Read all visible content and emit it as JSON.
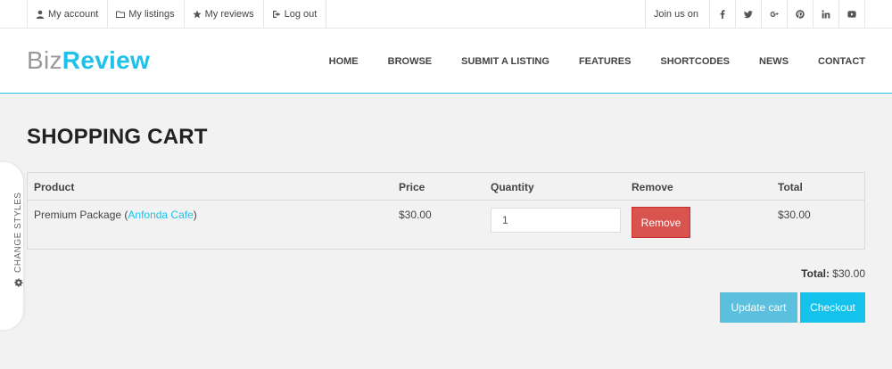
{
  "topbar": {
    "links": [
      {
        "label": "My account",
        "icon": "user-icon"
      },
      {
        "label": "My listings",
        "icon": "folder-icon"
      },
      {
        "label": "My reviews",
        "icon": "star-icon"
      },
      {
        "label": "Log out",
        "icon": "sign-out-icon"
      }
    ],
    "join_label": "Join us on",
    "social": [
      "facebook-icon",
      "twitter-icon",
      "google-plus-icon",
      "pinterest-icon",
      "linkedin-icon",
      "youtube-icon"
    ]
  },
  "logo": {
    "part1": "Biz",
    "part2": "Review"
  },
  "nav": {
    "items": [
      "HOME",
      "BROWSE",
      "SUBMIT A LISTING",
      "FEATURES",
      "SHORTCODES",
      "NEWS",
      "CONTACT"
    ]
  },
  "sidetab": {
    "label": "CHANGE STYLES",
    "icon": "gear-icon"
  },
  "page": {
    "title": "SHOPPING CART"
  },
  "cart": {
    "headers": {
      "product": "Product",
      "price": "Price",
      "quantity": "Quantity",
      "remove": "Remove",
      "total": "Total"
    },
    "rows": [
      {
        "product_name": "Premium Package",
        "product_open": "(",
        "product_link": "Anfonda Cafe",
        "product_close": ")",
        "price": "$30.00",
        "quantity": "1",
        "remove_label": "Remove",
        "total": "$30.00"
      }
    ]
  },
  "summary": {
    "total_label": "Total:",
    "total_value": "$30.00"
  },
  "buttons": {
    "update": "Update cart",
    "checkout": "Checkout"
  },
  "colors": {
    "accent": "#1ec1ea",
    "remove": "#d9534f",
    "update": "#5bc0de",
    "checkout": "#15c2ec"
  }
}
